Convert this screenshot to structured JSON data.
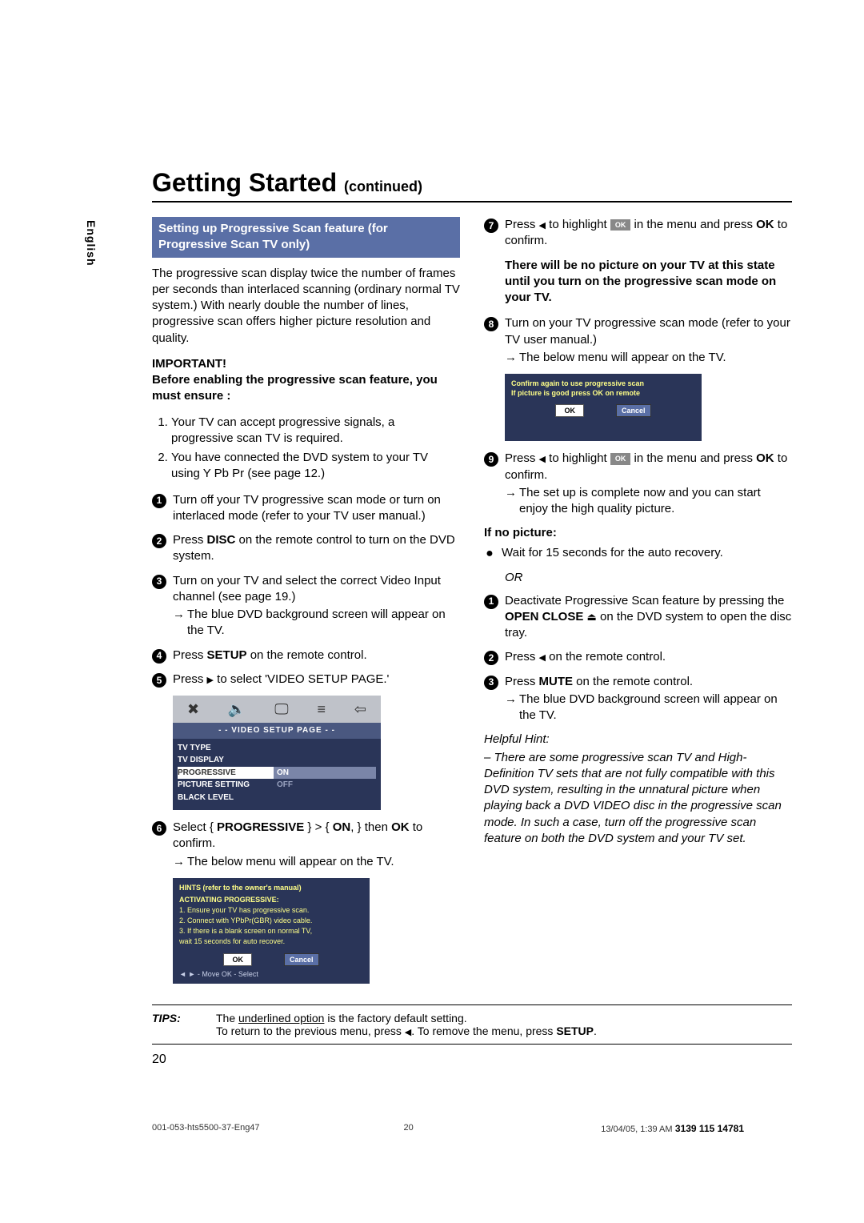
{
  "lang_tab": "English",
  "heading": "Getting Started",
  "heading_cont": "(continued)",
  "section_title": "Setting up Progressive Scan feature (for Progressive Scan TV only)",
  "intro": "The progressive scan display twice the number of frames per seconds than interlaced scanning (ordinary normal TV system.)  With nearly double the number of lines, progressive scan offers higher picture resolution and quality.",
  "important_label": "IMPORTANT!",
  "before_label": "Before enabling the progressive scan feature, you must ensure :",
  "ensure1": "Your TV can accept progressive signals, a progressive scan TV is required.",
  "ensure2": "You have connected the DVD system to your TV using Y Pb Pr (see page 12.)",
  "s1": "Turn off your TV progressive scan mode or turn on interlaced mode (refer to your TV user manual.)",
  "s2a": "Press ",
  "s2b": "DISC",
  "s2c": " on the remote control to turn on the DVD system.",
  "s3a": "Turn on your TV and select the correct Video Input channel (see page 19.)",
  "s3b": "The blue DVD background screen will appear on the TV.",
  "s4a": "Press ",
  "s4b": "SETUP",
  "s4c": " on the remote control.",
  "s5a": "Press ",
  "s5b": " to select 'VIDEO SETUP PAGE.'",
  "menu1_title": "- -   VIDEO  SETUP  PAGE   - -",
  "menu1_r1": "TV TYPE",
  "menu1_r2": "TV DISPLAY",
  "menu1_r3": "PROGRESSIVE",
  "menu1_r3v": "ON",
  "menu1_r4": "PICTURE SETTING",
  "menu1_r4v": "OFF",
  "menu1_r5": "BLACK LEVEL",
  "s6a": "Select { ",
  "s6b": "PROGRESSIVE",
  "s6c": " } > { ",
  "s6d": "ON",
  "s6e": ", } then ",
  "s6f": "OK",
  "s6g": " to confirm.",
  "s6h": "The below menu will appear on the TV.",
  "hints_title": "HINTS (refer to the owner's manual)",
  "hints_sub": "ACTIVATING PROGRESSIVE:",
  "hints_l1": "1. Ensure your TV has progressive scan.",
  "hints_l2": "2. Connect with YPbPr(GBR) video cable.",
  "hints_l3": "3. If there is a blank screen on normal TV,",
  "hints_l4": "   wait 15 seconds for auto recover.",
  "btn_ok": "OK",
  "btn_cancel": "Cancel",
  "nav_hint": "◄ ►  -  Move    OK  -  Select",
  "s7a": "Press ",
  "s7b": " to highlight ",
  "s7c": "OK",
  "s7d": " in the menu and press ",
  "s7e": "OK",
  "s7f": " to confirm.",
  "warn": "There will be no picture on your TV at this state until you turn on the progressive scan mode on your TV.",
  "s8a": "Turn on your TV progressive scan mode (refer to your TV user manual.)",
  "s8b": "The below menu will appear on the TV.",
  "confirm_l1": "Confirm again to use progressive scan",
  "confirm_l2": "If picture is good press OK on remote",
  "s9a": "Press ",
  "s9b": " to highlight ",
  "s9c": "OK",
  "s9d": " in the menu and press ",
  "s9e": "OK",
  "s9f": " to confirm.",
  "s9g": "The set up is complete now and you can start enjoy the high quality picture.",
  "if_no_pic": "If no picture:",
  "nop_wait": "Wait for 15 seconds for the auto recovery.",
  "or_label": "OR",
  "d1a": "Deactivate Progressive Scan feature by pressing the ",
  "d1b": "OPEN CLOSE",
  "d1c": " on the DVD system to open the disc tray.",
  "d2a": "Press ",
  "d2b": " on the remote control.",
  "d3a": "Press ",
  "d3b": "MUTE",
  "d3c": " on the remote control.",
  "d3d": "The blue DVD background screen will appear on the TV.",
  "hint_label": "Helpful Hint:",
  "hint_body": "–  There are some progressive scan TV and High-Definition TV sets that are not fully compatible with this DVD system, resulting in the unnatural picture when playing back a DVD VIDEO disc in the progressive scan mode.  In such a case, turn off the progressive scan feature on both the DVD system and your TV set.",
  "tips_label": "TIPS:",
  "tips_l1a": "The ",
  "tips_l1b": "underlined option",
  "tips_l1c": " is the factory default setting.",
  "tips_l2a": "To return to the previous menu, press ",
  "tips_l2b": ".  To remove the menu, press ",
  "tips_l2c": "SETUP",
  "tips_l2d": ".",
  "page_num": "20",
  "foot_left": "001-053-hts5500-37-Eng47",
  "foot_mid": "20",
  "foot_right1": "13/04/05, 1:39 AM",
  "foot_right2": "3139 115 14781"
}
